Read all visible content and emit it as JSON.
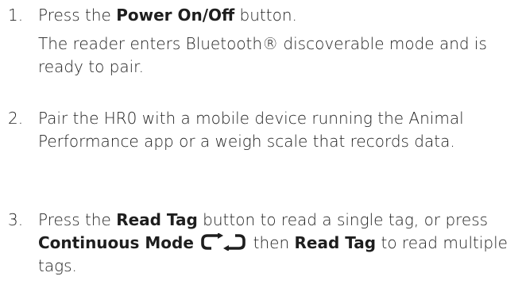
{
  "steps": [
    {
      "number": "1.",
      "prefix": "Press the ",
      "bold1": "Power On/Off",
      "suffix": " button.",
      "note": "The reader enters Bluetooth® discoverable mode and is ready to pair."
    },
    {
      "number": "2.",
      "text": "Pair the HR0 with a mobile device running the Animal Performance app or a weigh scale that records data."
    },
    {
      "number": "3.",
      "prefix": "Press the ",
      "bold1": "Read Tag",
      "middle1": " button to read a single tag, or press ",
      "bold2": "Continuous Mode",
      "icon": "continuous-mode-loop-icon",
      "middle2": " then ",
      "bold3": "Read Tag",
      "suffix": " to read multiple tags."
    }
  ],
  "colors": {
    "text": "#1e1e1e",
    "background": "#ffffff"
  }
}
